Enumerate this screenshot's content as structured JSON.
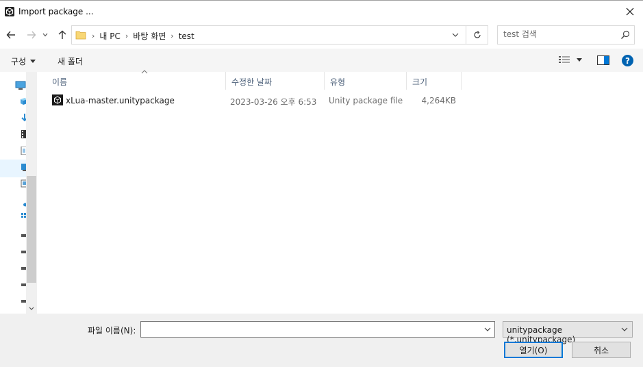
{
  "window": {
    "title": "Import package ..."
  },
  "address": {
    "crumbs": [
      "내 PC",
      "바탕 화면",
      "test"
    ]
  },
  "search": {
    "placeholder": "test 검색"
  },
  "toolbar": {
    "organize_label": "구성",
    "new_folder_label": "새 폴더"
  },
  "columns": {
    "name": "이름",
    "date": "수정한 날짜",
    "type": "유형",
    "size": "크기"
  },
  "files": [
    {
      "name": "xLua-master.unitypackage",
      "date": "2023-03-26 오후 6:53",
      "type": "Unity package file",
      "size": "4,264KB"
    }
  ],
  "bottom": {
    "filename_label": "파일 이름(N):",
    "filename_value": "",
    "filter_value": "unitypackage (*.unitypackage)",
    "open_label": "열기(O)",
    "cancel_label": "취소"
  },
  "colors": {
    "accent": "#0078d7",
    "help": "#0063b1",
    "folder": "#f8d775"
  }
}
